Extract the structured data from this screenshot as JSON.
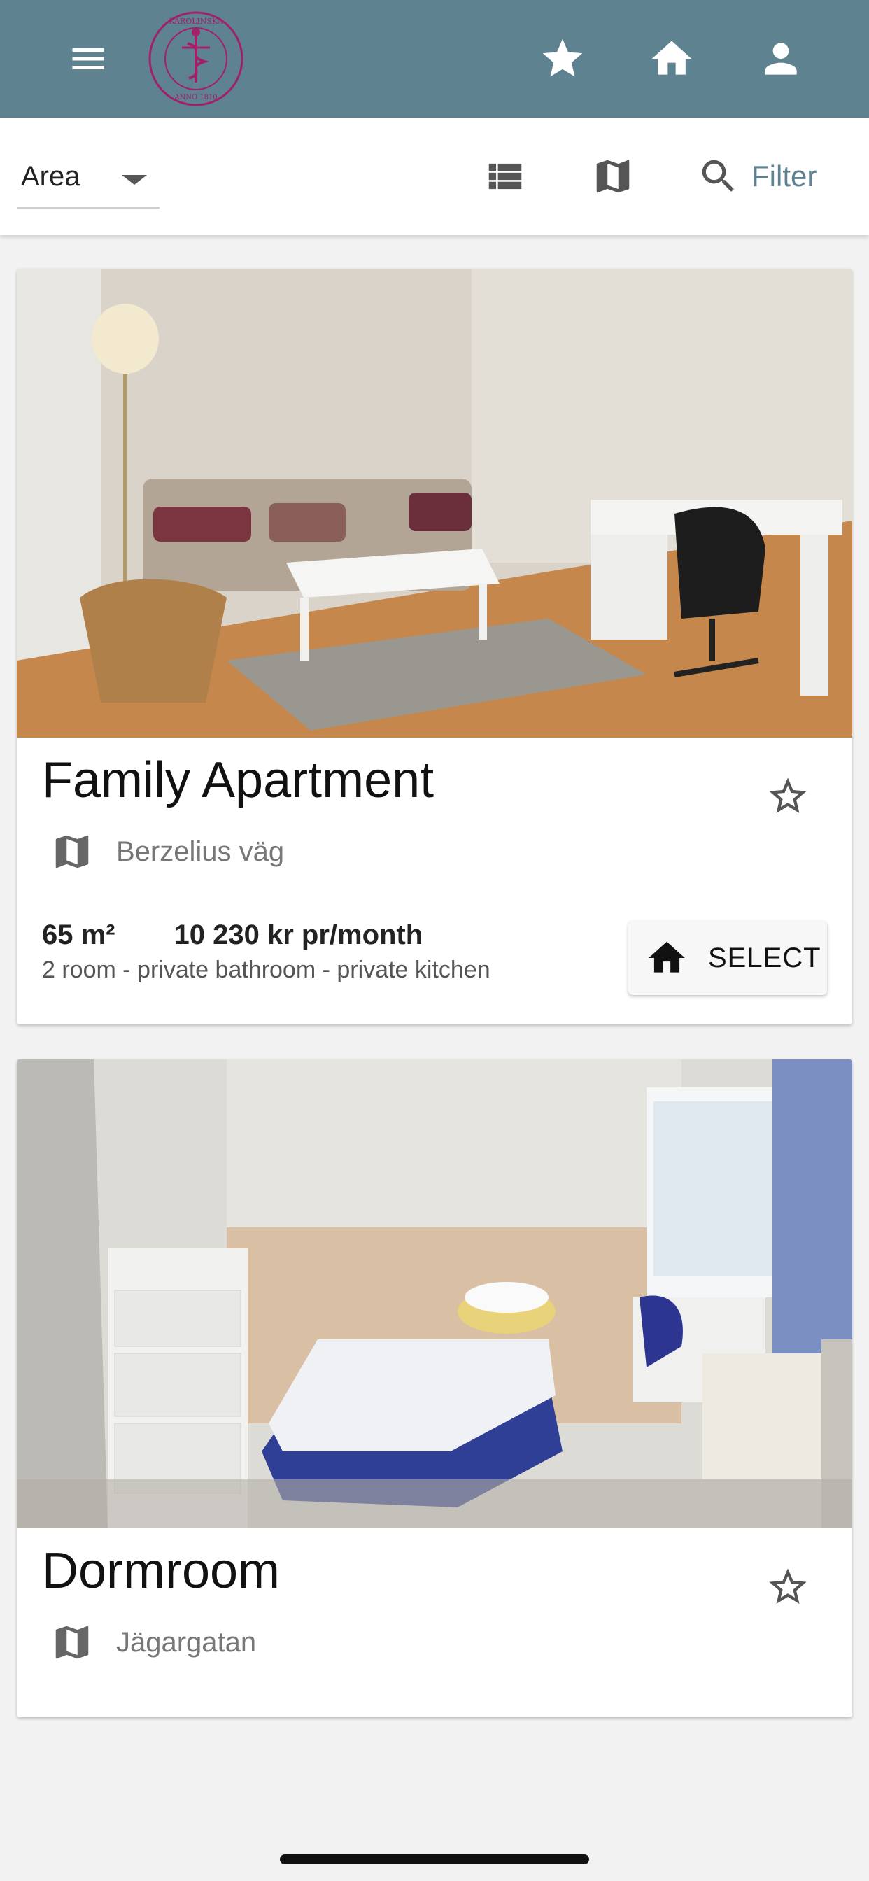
{
  "appbar": {
    "menu_icon": "hamburger-menu-icon",
    "logo_alt": "Karolinska Institutet logo",
    "logo_text": "KAROLINSKA INSTITUTET · ANNO 1810",
    "icons": [
      "star-icon",
      "home-icon",
      "person-icon"
    ],
    "bg_color": "#5f8291"
  },
  "toolbar": {
    "area_label": "Area",
    "filter_label": "Filter",
    "icons": [
      "list-view-icon",
      "map-view-icon",
      "search-icon"
    ],
    "accent_color": "#5f8291"
  },
  "listings": [
    {
      "title": "Family Apartment",
      "location": "Berzelius väg",
      "size": "65 m²",
      "price": "10 230 kr pr/month",
      "details": "2 room - private bathroom - private kitchen",
      "select_label": "SELECT"
    },
    {
      "title": "Dormroom",
      "location": "Jägargatan"
    }
  ]
}
